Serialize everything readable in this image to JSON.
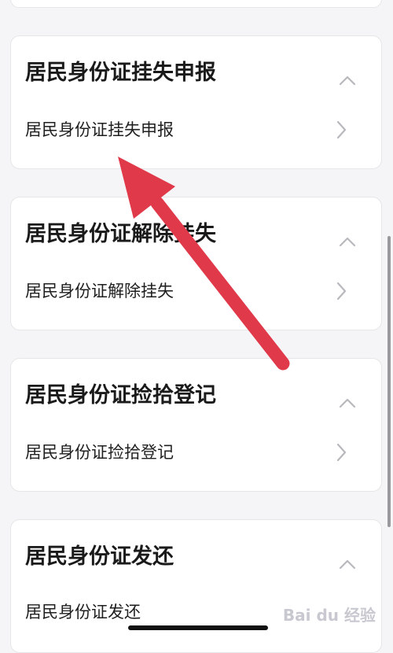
{
  "cards": [
    {
      "title": "居民身份证挂失申报",
      "item": "居民身份证挂失申报"
    },
    {
      "title": "居民身份证解除挂失",
      "item": "居民身份证解除挂失"
    },
    {
      "title": "居民身份证捡拾登记",
      "item": "居民身份证捡拾登记"
    },
    {
      "title": "居民身份证发还",
      "item": "居民身份证发还"
    }
  ],
  "watermark": "Bai du 经验",
  "colors": {
    "arrow": "#e0394a",
    "card_border": "#e6e6e9",
    "background": "#f5f5f7",
    "chevron": "#b8b8bd"
  }
}
